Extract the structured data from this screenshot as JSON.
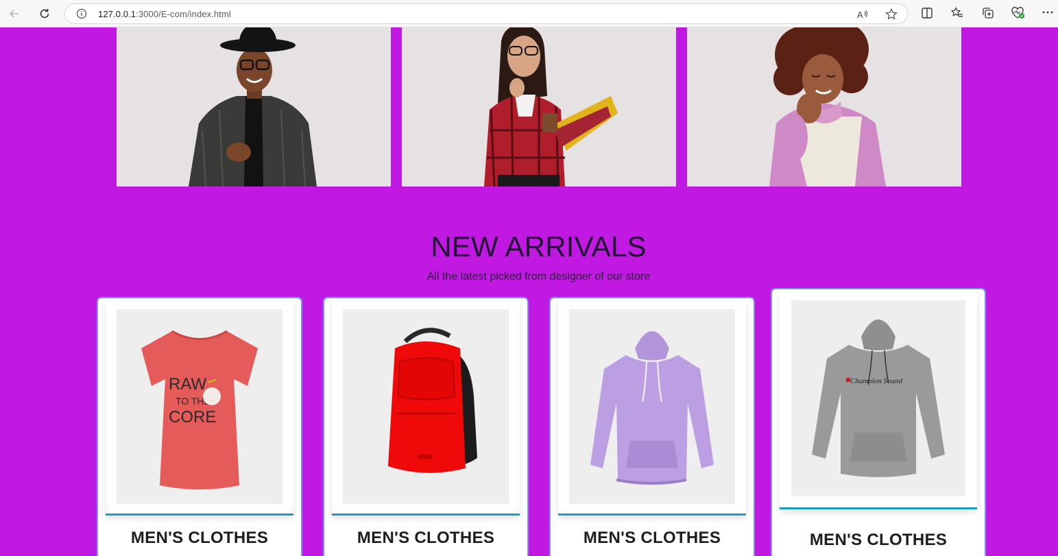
{
  "browser": {
    "url_host": "127.0.0.1",
    "url_path": ":3000/E-com/index.html"
  },
  "hero": [
    {
      "name": "man-in-hat"
    },
    {
      "name": "woman-with-folders"
    },
    {
      "name": "woman-curly-hair"
    }
  ],
  "section": {
    "title": "NEW ARRIVALS",
    "subtitle": "All the latest picked from designer of our store"
  },
  "products": [
    {
      "title": "MEN'S CLOTHES",
      "image": "red-tshirt"
    },
    {
      "title": "MEN'S CLOTHES",
      "image": "red-backpack"
    },
    {
      "title": "MEN'S CLOTHES",
      "image": "lavender-hoodie"
    },
    {
      "title": "MEN'S CLOTHES",
      "image": "grey-hoodie"
    }
  ],
  "colors": {
    "page_bg": "#bf19e2",
    "card_border": "#7b8ff0",
    "card_accent": "#1b9fb8"
  }
}
